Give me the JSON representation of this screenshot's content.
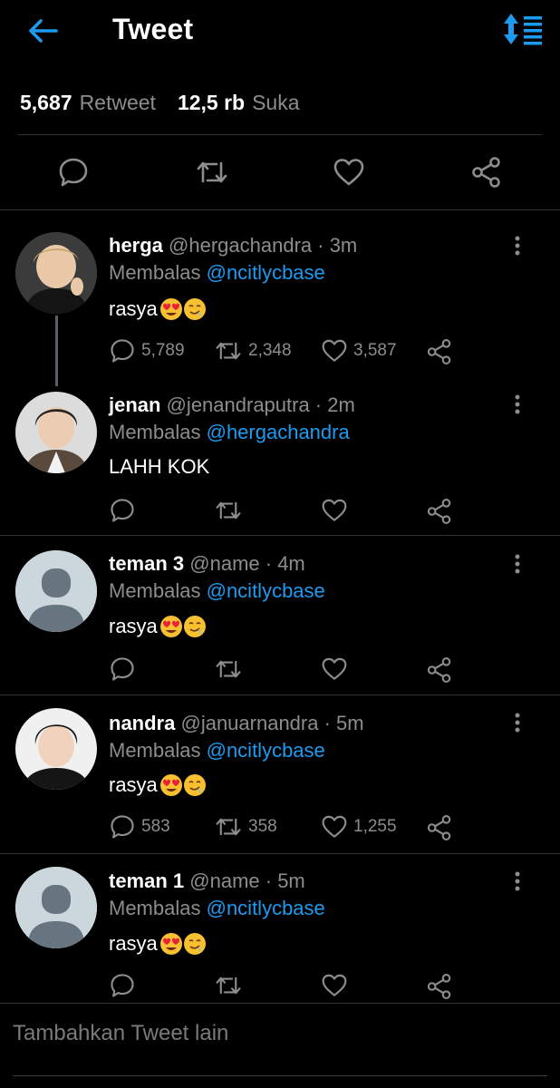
{
  "header": {
    "title": "Tweet",
    "accent": "#1d9bf0"
  },
  "stats": {
    "retweets": "5,687",
    "retweets_label": "Retweet",
    "likes": "12,5 rb",
    "likes_label": "Suka"
  },
  "actions": [
    "reply-icon",
    "retweet-icon",
    "like-icon",
    "share-icon"
  ],
  "replies": [
    {
      "name": "herga",
      "handle": "@hergachandra · 3m",
      "reply_prefix": "Membalas",
      "mention": "@ncitlycbase",
      "text": "rasya",
      "counts": {
        "reply": "5,789",
        "retweet": "2,348",
        "like": "3,587"
      }
    },
    {
      "name": "jenan",
      "handle": "@jenandraputra · 2m",
      "reply_prefix": "Membalas",
      "mention": "@hergachandra",
      "text": "LAHH KOK",
      "counts": {
        "reply": "",
        "retweet": "",
        "like": ""
      }
    },
    {
      "name": "teman 3",
      "handle": "@name · 4m",
      "reply_prefix": "Membalas",
      "mention": "@ncitlycbase",
      "text": "rasya",
      "counts": {
        "reply": "",
        "retweet": "",
        "like": ""
      }
    },
    {
      "name": "nandra",
      "handle": "@januarnandra · 5m",
      "reply_prefix": "Membalas",
      "mention": "@ncitlycbase",
      "text": "rasya",
      "counts": {
        "reply": "583",
        "retweet": "358",
        "like": "1,255"
      }
    },
    {
      "name": "teman 1",
      "handle": "@name · 5m",
      "reply_prefix": "Membalas",
      "mention": "@ncitlycbase",
      "text": "rasya",
      "counts": {
        "reply": "",
        "retweet": "",
        "like": ""
      }
    }
  ],
  "composer": {
    "placeholder": "Tambahkan Tweet lain"
  }
}
